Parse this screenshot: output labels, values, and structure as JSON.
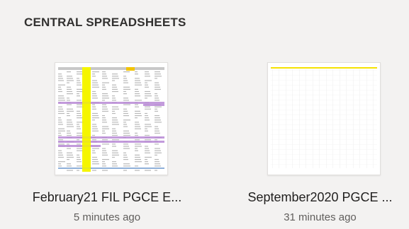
{
  "section": {
    "title": "CENTRAL SPREADSHEETS"
  },
  "files": [
    {
      "name": "February21 FIL PGCE E...",
      "modified": "5 minutes ago",
      "thumbnail": "spreadsheet-thumbnail-dense"
    },
    {
      "name": "September2020 PGCE ...",
      "modified": "31 minutes ago",
      "thumbnail": "spreadsheet-thumbnail-sparse"
    }
  ],
  "colors": {
    "background": "#f3f2f1",
    "highlight_yellow": "#f5f500",
    "highlight_purple": "#b98ad6",
    "highlight_blue": "#8fb0d9"
  }
}
